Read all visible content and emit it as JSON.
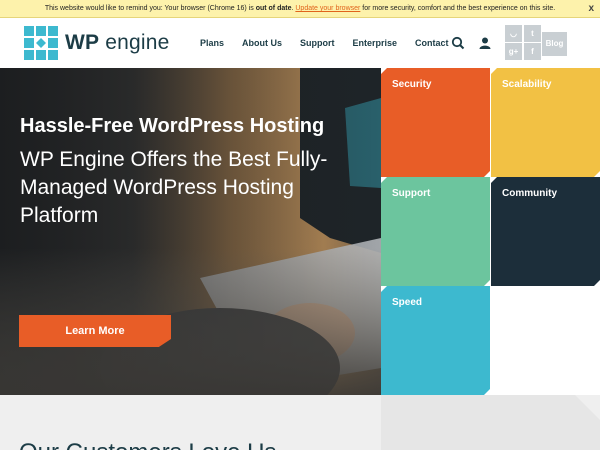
{
  "update_bar": {
    "text_before": "This website would like to remind you: Your browser (Chrome 16) is ",
    "bold": "out of date",
    "text_mid": ". ",
    "link": "Update your browser",
    "text_after": " for more security, comfort and the best experience on this site.",
    "close": "x"
  },
  "header": {
    "logo_wp": "WP",
    "logo_engine": "engine",
    "nav": [
      "Plans",
      "About Us",
      "Support",
      "Enterprise",
      "Contact"
    ],
    "social": [
      "rss",
      "twitter",
      "g+",
      "f"
    ],
    "social_glyphs": [
      "◡",
      "t",
      "g+",
      "f"
    ],
    "blog": "Blog"
  },
  "hero": {
    "title": "Hassle-Free WordPress Hosting",
    "subtitle": "WP Engine Offers the Best Fully-Managed WordPress Hosting Platform",
    "cta": "Learn More"
  },
  "features": [
    {
      "label": "Security",
      "color": "#e85d27"
    },
    {
      "label": "Scalability",
      "color": "#f2c144"
    },
    {
      "label": "Support",
      "color": "#6cc59e"
    },
    {
      "label": "Community",
      "color": "#1c2e3a"
    },
    {
      "label": "Speed",
      "color": "#3db9cf"
    }
  ],
  "lower": {
    "title": "Our Customers Love Us"
  },
  "colors": {
    "accent": "#e85d27",
    "brand_dark": "#1c3c46",
    "brand_teal": "#3db9cf"
  }
}
